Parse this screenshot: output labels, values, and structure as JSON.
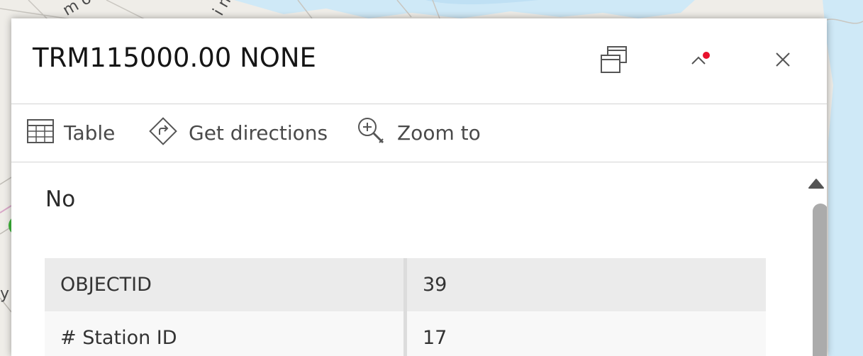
{
  "map": {
    "labels": [
      {
        "text": "m o"
      },
      {
        "text": "i n"
      },
      {
        "text": "y"
      }
    ]
  },
  "popup": {
    "title": "TRM115000.00 NONE",
    "header_buttons": [
      {
        "name": "dock-icon"
      },
      {
        "name": "collapse-icon"
      },
      {
        "name": "close-icon"
      }
    ],
    "actions": [
      {
        "label": "Table",
        "icon": "table-icon"
      },
      {
        "label": "Get directions",
        "icon": "directions-icon"
      },
      {
        "label": "Zoom to",
        "icon": "zoom-to-icon"
      }
    ],
    "content": {
      "text": "No",
      "attributes": [
        {
          "key": "OBJECTID",
          "value": "39"
        },
        {
          "key": "# Station ID",
          "value": "17"
        }
      ]
    },
    "colors": {
      "notification_dot": "#e8112d",
      "water": "#cfe9f7",
      "road_pink": "#d9a8c8"
    }
  }
}
